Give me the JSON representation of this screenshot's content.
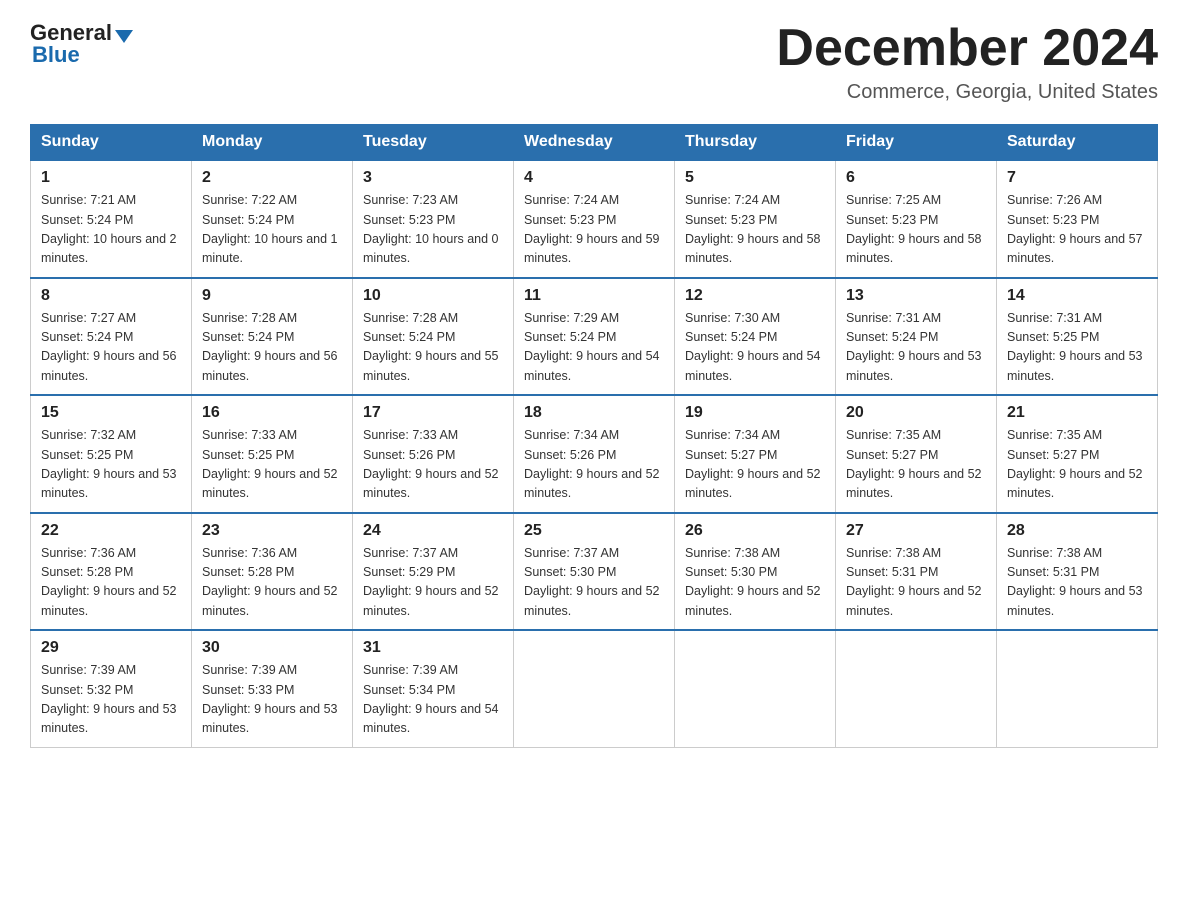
{
  "header": {
    "logo": {
      "general": "General",
      "arrow_color": "#1a6aad",
      "blue": "Blue"
    },
    "title": "December 2024",
    "location": "Commerce, Georgia, United States"
  },
  "days_of_week": [
    "Sunday",
    "Monday",
    "Tuesday",
    "Wednesday",
    "Thursday",
    "Friday",
    "Saturday"
  ],
  "weeks": [
    [
      {
        "day": "1",
        "sunrise": "7:21 AM",
        "sunset": "5:24 PM",
        "daylight": "10 hours and 2 minutes."
      },
      {
        "day": "2",
        "sunrise": "7:22 AM",
        "sunset": "5:24 PM",
        "daylight": "10 hours and 1 minute."
      },
      {
        "day": "3",
        "sunrise": "7:23 AM",
        "sunset": "5:23 PM",
        "daylight": "10 hours and 0 minutes."
      },
      {
        "day": "4",
        "sunrise": "7:24 AM",
        "sunset": "5:23 PM",
        "daylight": "9 hours and 59 minutes."
      },
      {
        "day": "5",
        "sunrise": "7:24 AM",
        "sunset": "5:23 PM",
        "daylight": "9 hours and 58 minutes."
      },
      {
        "day": "6",
        "sunrise": "7:25 AM",
        "sunset": "5:23 PM",
        "daylight": "9 hours and 58 minutes."
      },
      {
        "day": "7",
        "sunrise": "7:26 AM",
        "sunset": "5:23 PM",
        "daylight": "9 hours and 57 minutes."
      }
    ],
    [
      {
        "day": "8",
        "sunrise": "7:27 AM",
        "sunset": "5:24 PM",
        "daylight": "9 hours and 56 minutes."
      },
      {
        "day": "9",
        "sunrise": "7:28 AM",
        "sunset": "5:24 PM",
        "daylight": "9 hours and 56 minutes."
      },
      {
        "day": "10",
        "sunrise": "7:28 AM",
        "sunset": "5:24 PM",
        "daylight": "9 hours and 55 minutes."
      },
      {
        "day": "11",
        "sunrise": "7:29 AM",
        "sunset": "5:24 PM",
        "daylight": "9 hours and 54 minutes."
      },
      {
        "day": "12",
        "sunrise": "7:30 AM",
        "sunset": "5:24 PM",
        "daylight": "9 hours and 54 minutes."
      },
      {
        "day": "13",
        "sunrise": "7:31 AM",
        "sunset": "5:24 PM",
        "daylight": "9 hours and 53 minutes."
      },
      {
        "day": "14",
        "sunrise": "7:31 AM",
        "sunset": "5:25 PM",
        "daylight": "9 hours and 53 minutes."
      }
    ],
    [
      {
        "day": "15",
        "sunrise": "7:32 AM",
        "sunset": "5:25 PM",
        "daylight": "9 hours and 53 minutes."
      },
      {
        "day": "16",
        "sunrise": "7:33 AM",
        "sunset": "5:25 PM",
        "daylight": "9 hours and 52 minutes."
      },
      {
        "day": "17",
        "sunrise": "7:33 AM",
        "sunset": "5:26 PM",
        "daylight": "9 hours and 52 minutes."
      },
      {
        "day": "18",
        "sunrise": "7:34 AM",
        "sunset": "5:26 PM",
        "daylight": "9 hours and 52 minutes."
      },
      {
        "day": "19",
        "sunrise": "7:34 AM",
        "sunset": "5:27 PM",
        "daylight": "9 hours and 52 minutes."
      },
      {
        "day": "20",
        "sunrise": "7:35 AM",
        "sunset": "5:27 PM",
        "daylight": "9 hours and 52 minutes."
      },
      {
        "day": "21",
        "sunrise": "7:35 AM",
        "sunset": "5:27 PM",
        "daylight": "9 hours and 52 minutes."
      }
    ],
    [
      {
        "day": "22",
        "sunrise": "7:36 AM",
        "sunset": "5:28 PM",
        "daylight": "9 hours and 52 minutes."
      },
      {
        "day": "23",
        "sunrise": "7:36 AM",
        "sunset": "5:28 PM",
        "daylight": "9 hours and 52 minutes."
      },
      {
        "day": "24",
        "sunrise": "7:37 AM",
        "sunset": "5:29 PM",
        "daylight": "9 hours and 52 minutes."
      },
      {
        "day": "25",
        "sunrise": "7:37 AM",
        "sunset": "5:30 PM",
        "daylight": "9 hours and 52 minutes."
      },
      {
        "day": "26",
        "sunrise": "7:38 AM",
        "sunset": "5:30 PM",
        "daylight": "9 hours and 52 minutes."
      },
      {
        "day": "27",
        "sunrise": "7:38 AM",
        "sunset": "5:31 PM",
        "daylight": "9 hours and 52 minutes."
      },
      {
        "day": "28",
        "sunrise": "7:38 AM",
        "sunset": "5:31 PM",
        "daylight": "9 hours and 53 minutes."
      }
    ],
    [
      {
        "day": "29",
        "sunrise": "7:39 AM",
        "sunset": "5:32 PM",
        "daylight": "9 hours and 53 minutes."
      },
      {
        "day": "30",
        "sunrise": "7:39 AM",
        "sunset": "5:33 PM",
        "daylight": "9 hours and 53 minutes."
      },
      {
        "day": "31",
        "sunrise": "7:39 AM",
        "sunset": "5:34 PM",
        "daylight": "9 hours and 54 minutes."
      },
      null,
      null,
      null,
      null
    ]
  ],
  "labels": {
    "sunrise": "Sunrise:",
    "sunset": "Sunset:",
    "daylight": "Daylight:"
  }
}
